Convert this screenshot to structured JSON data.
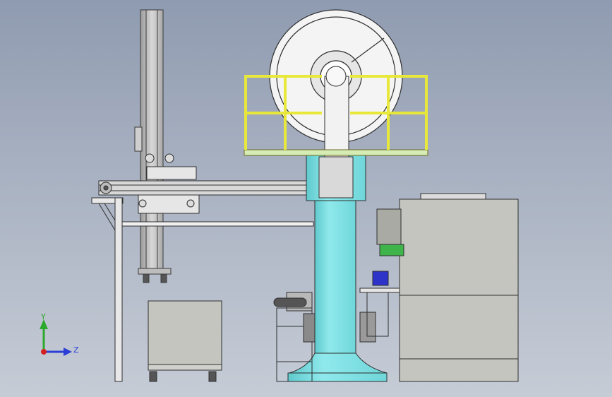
{
  "viewport": {
    "background_top": "#8f9bb0",
    "background_bottom": "#c6ccd6"
  },
  "colors": {
    "column": "#7fe3e6",
    "railing": "#f2f25a",
    "platform": "#d6ecb5",
    "steel": "#c9c9c9",
    "cabinet": "#c4c5bf",
    "part_blue": "#2d32c8",
    "part_green": "#3fb44a"
  },
  "triad": {
    "y_label": "Y",
    "z_label": "Z",
    "y_color": "#2ca82c",
    "z_color": "#2b3fd6",
    "x_color": "#d42020"
  }
}
